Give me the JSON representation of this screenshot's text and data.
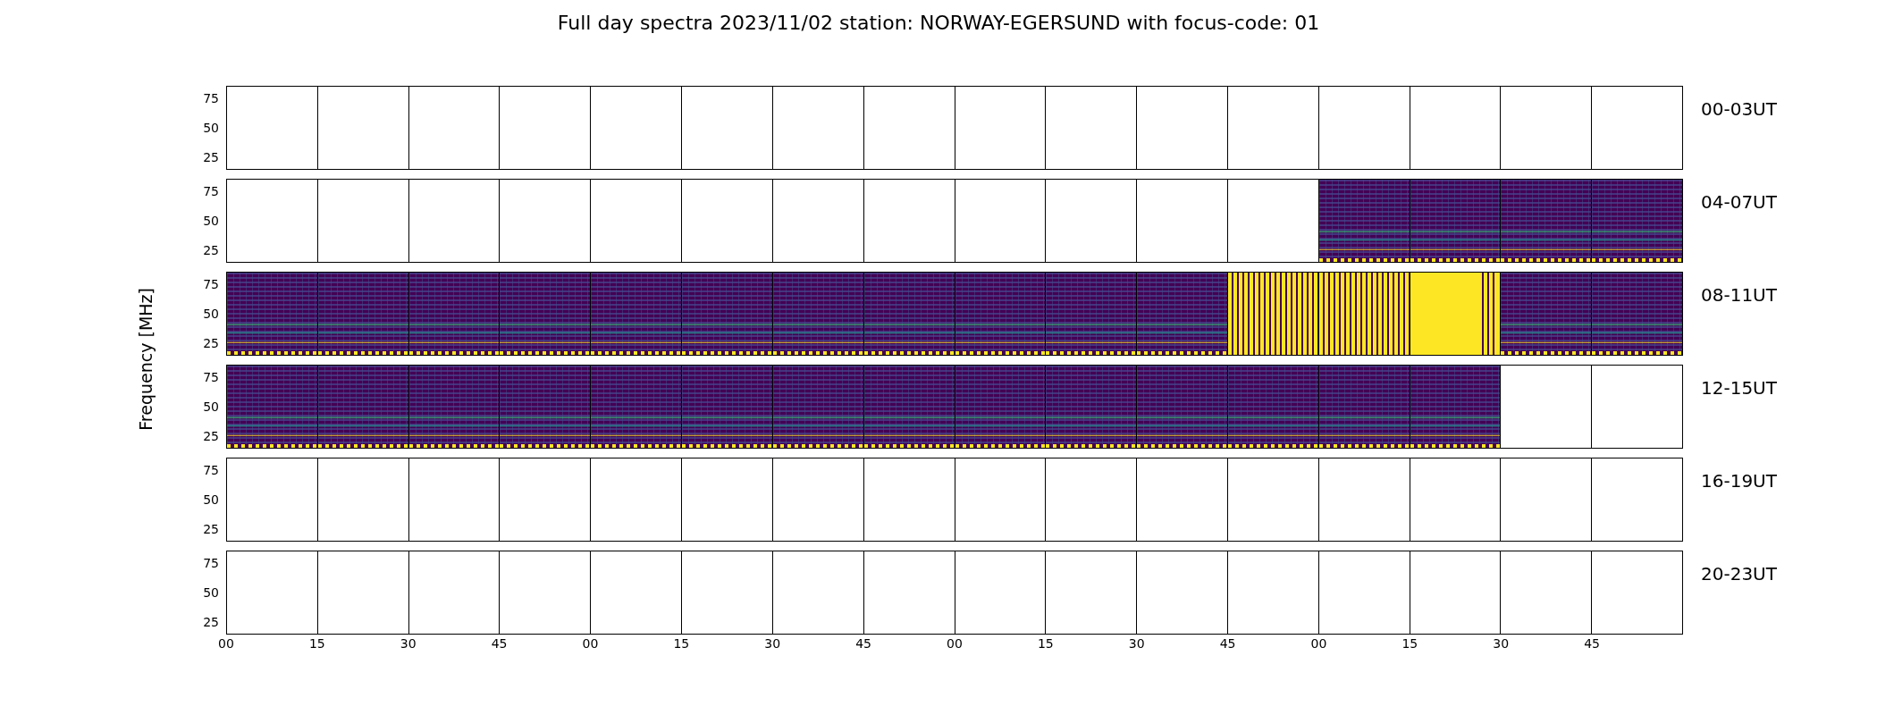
{
  "title": "Full day spectra 2023/11/02 station: NORWAY-EGERSUND with focus-code: 01",
  "y_label": "Frequency [MHz]",
  "x_ticks": [
    "00",
    "15",
    "30",
    "45",
    "00",
    "15",
    "30",
    "45",
    "00",
    "15",
    "30",
    "45",
    "00",
    "15",
    "30",
    "45"
  ],
  "rows": [
    {
      "label": "00-03UT",
      "y_ticks": [
        "75",
        "50",
        "25"
      ],
      "panels": [
        {
          "kind": "empty"
        },
        {
          "kind": "empty"
        },
        {
          "kind": "empty"
        },
        {
          "kind": "empty"
        },
        {
          "kind": "empty"
        },
        {
          "kind": "empty"
        },
        {
          "kind": "empty"
        },
        {
          "kind": "empty"
        },
        {
          "kind": "empty"
        },
        {
          "kind": "empty"
        },
        {
          "kind": "empty"
        },
        {
          "kind": "empty"
        },
        {
          "kind": "empty"
        },
        {
          "kind": "empty"
        },
        {
          "kind": "empty"
        },
        {
          "kind": "empty"
        }
      ]
    },
    {
      "label": "04-07UT",
      "y_ticks": [
        "75",
        "50",
        "25"
      ],
      "panels": [
        {
          "kind": "empty"
        },
        {
          "kind": "empty"
        },
        {
          "kind": "empty"
        },
        {
          "kind": "empty"
        },
        {
          "kind": "empty"
        },
        {
          "kind": "empty"
        },
        {
          "kind": "empty"
        },
        {
          "kind": "empty"
        },
        {
          "kind": "empty"
        },
        {
          "kind": "empty"
        },
        {
          "kind": "empty"
        },
        {
          "kind": "empty"
        },
        {
          "kind": "spectrogram"
        },
        {
          "kind": "spectrogram"
        },
        {
          "kind": "spectrogram"
        },
        {
          "kind": "spectrogram"
        }
      ]
    },
    {
      "label": "08-11UT",
      "y_ticks": [
        "75",
        "50",
        "25"
      ],
      "panels": [
        {
          "kind": "spectrogram"
        },
        {
          "kind": "spectrogram"
        },
        {
          "kind": "spectrogram"
        },
        {
          "kind": "spectrogram"
        },
        {
          "kind": "spectrogram"
        },
        {
          "kind": "spectrogram"
        },
        {
          "kind": "spectrogram"
        },
        {
          "kind": "spectrogram"
        },
        {
          "kind": "spectrogram"
        },
        {
          "kind": "spectrogram"
        },
        {
          "kind": "spectrogram"
        },
        {
          "kind": "striped"
        },
        {
          "kind": "striped"
        },
        {
          "kind": "saturated"
        },
        {
          "kind": "spectrogram"
        },
        {
          "kind": "spectrogram"
        }
      ]
    },
    {
      "label": "12-15UT",
      "y_ticks": [
        "75",
        "50",
        "25"
      ],
      "panels": [
        {
          "kind": "spectrogram"
        },
        {
          "kind": "spectrogram"
        },
        {
          "kind": "spectrogram"
        },
        {
          "kind": "spectrogram"
        },
        {
          "kind": "spectrogram"
        },
        {
          "kind": "spectrogram"
        },
        {
          "kind": "spectrogram"
        },
        {
          "kind": "spectrogram"
        },
        {
          "kind": "spectrogram"
        },
        {
          "kind": "spectrogram"
        },
        {
          "kind": "spectrogram"
        },
        {
          "kind": "spectrogram"
        },
        {
          "kind": "spectrogram"
        },
        {
          "kind": "spectrogram"
        },
        {
          "kind": "empty"
        },
        {
          "kind": "empty"
        }
      ]
    },
    {
      "label": "16-19UT",
      "y_ticks": [
        "75",
        "50",
        "25"
      ],
      "panels": [
        {
          "kind": "empty"
        },
        {
          "kind": "empty"
        },
        {
          "kind": "empty"
        },
        {
          "kind": "empty"
        },
        {
          "kind": "empty"
        },
        {
          "kind": "empty"
        },
        {
          "kind": "empty"
        },
        {
          "kind": "empty"
        },
        {
          "kind": "empty"
        },
        {
          "kind": "empty"
        },
        {
          "kind": "empty"
        },
        {
          "kind": "empty"
        },
        {
          "kind": "empty"
        },
        {
          "kind": "empty"
        },
        {
          "kind": "empty"
        },
        {
          "kind": "empty"
        }
      ]
    },
    {
      "label": "20-23UT",
      "y_ticks": [
        "75",
        "50",
        "25"
      ],
      "panels": [
        {
          "kind": "empty"
        },
        {
          "kind": "empty"
        },
        {
          "kind": "empty"
        },
        {
          "kind": "empty"
        },
        {
          "kind": "empty"
        },
        {
          "kind": "empty"
        },
        {
          "kind": "empty"
        },
        {
          "kind": "empty"
        },
        {
          "kind": "empty"
        },
        {
          "kind": "empty"
        },
        {
          "kind": "empty"
        },
        {
          "kind": "empty"
        },
        {
          "kind": "empty"
        },
        {
          "kind": "empty"
        },
        {
          "kind": "empty"
        },
        {
          "kind": "empty"
        }
      ]
    }
  ]
}
